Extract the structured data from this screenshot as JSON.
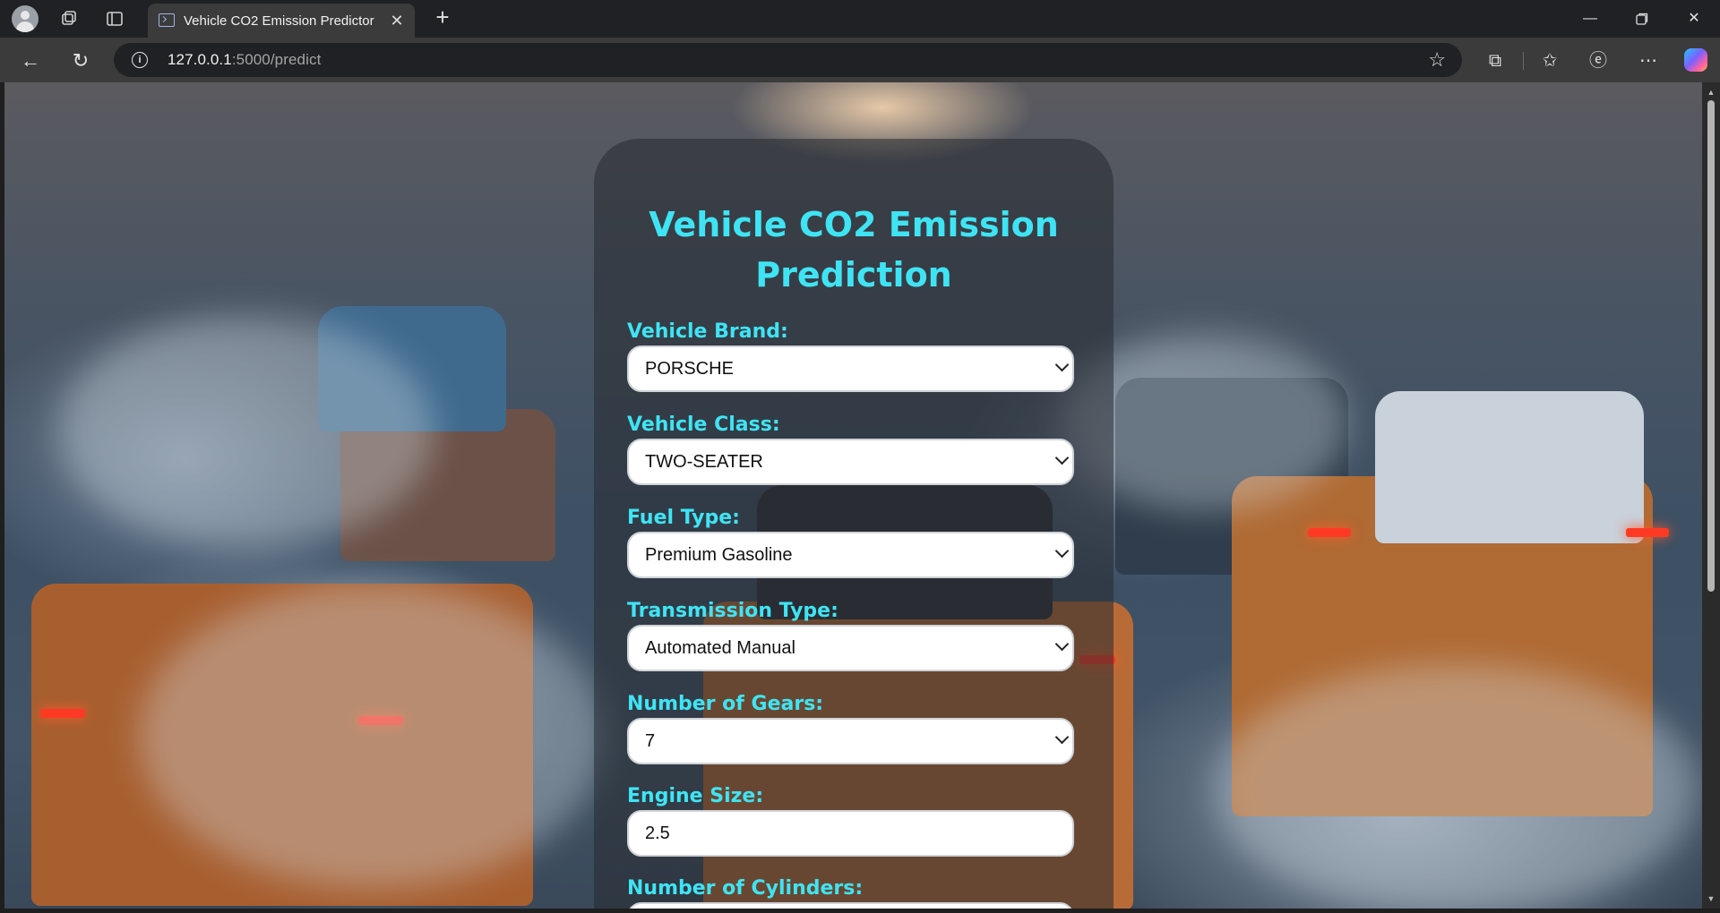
{
  "browser": {
    "tab_title": "Vehicle CO2 Emission Predictor",
    "url_host": "127.0.0.1",
    "url_path": ":5000/predict"
  },
  "form": {
    "heading_line1": "Vehicle CO2 Emission",
    "heading_line2": "Prediction",
    "fields": [
      {
        "label": "Vehicle Brand:",
        "value": "PORSCHE",
        "type": "select"
      },
      {
        "label": "Vehicle Class:",
        "value": "TWO-SEATER",
        "type": "select"
      },
      {
        "label": "Fuel Type:",
        "value": "Premium Gasoline",
        "type": "select"
      },
      {
        "label": "Transmission Type:",
        "value": "Automated Manual",
        "type": "select"
      },
      {
        "label": "Number of Gears:",
        "value": "7",
        "type": "select"
      },
      {
        "label": "Engine Size:",
        "value": "2.5",
        "type": "input"
      },
      {
        "label": "Number of Cylinders:",
        "value": "",
        "type": "input"
      }
    ]
  },
  "colors": {
    "accent": "#3fe4f4",
    "chrome_bg": "#202124",
    "toolbar_bg": "#3b3b3b"
  }
}
